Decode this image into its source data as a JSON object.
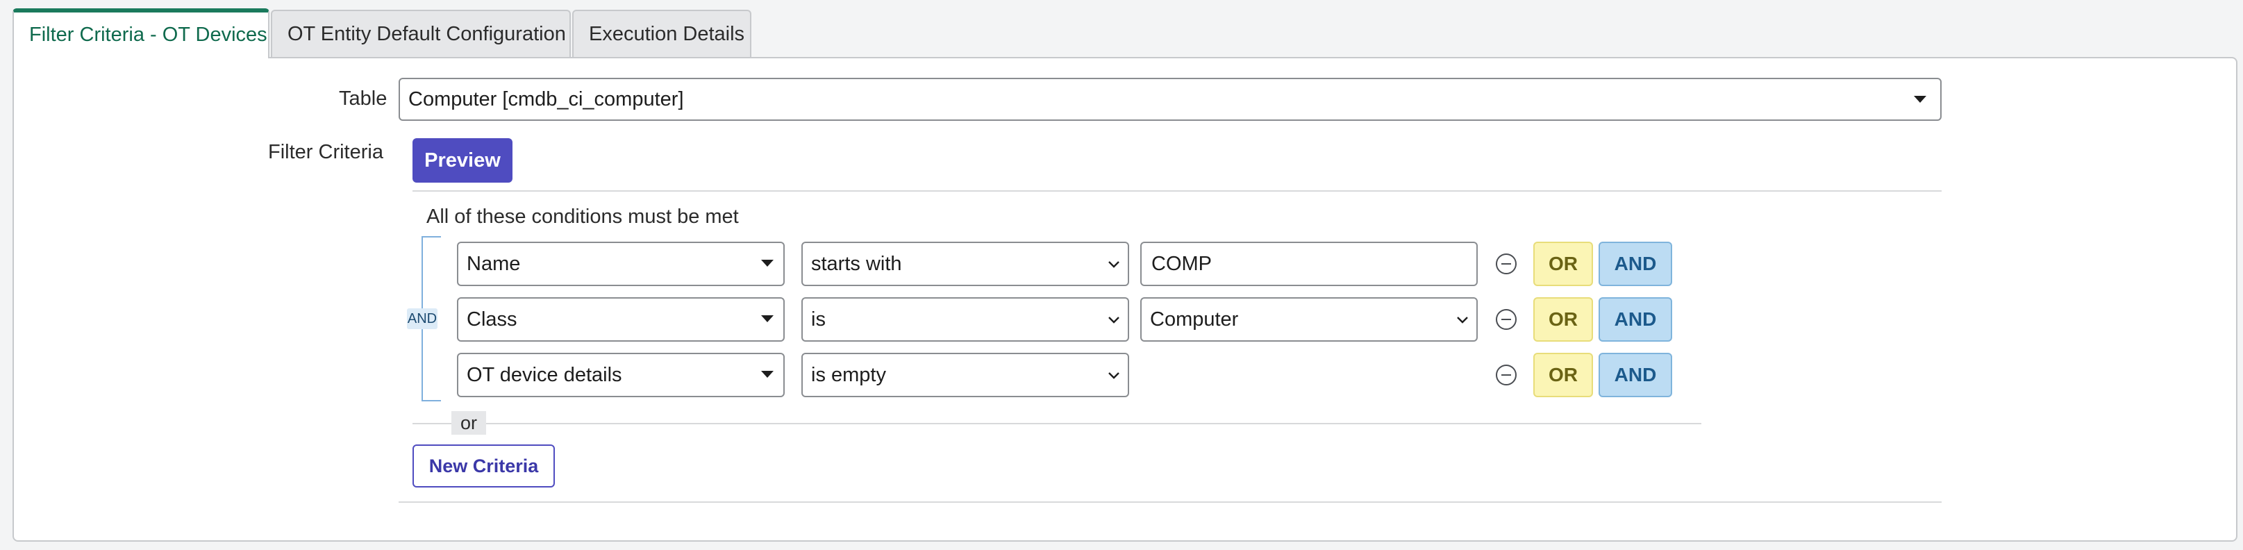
{
  "tabs": [
    {
      "label": "Filter Criteria - OT Devices",
      "active": true
    },
    {
      "label": "OT Entity Default Configuration",
      "active": false
    },
    {
      "label": "Execution Details",
      "active": false
    }
  ],
  "form": {
    "table_label": "Table",
    "table_value": "Computer [cmdb_ci_computer]",
    "filter_label": "Filter Criteria",
    "preview_label": "Preview"
  },
  "conditions": {
    "heading": "All of these conditions must be met",
    "group_operator": "AND",
    "rows": [
      {
        "field": "Name",
        "operator": "starts with",
        "value": "COMP",
        "value_type": "text"
      },
      {
        "field": "Class",
        "operator": "is",
        "value": "Computer",
        "value_type": "select"
      },
      {
        "field": "OT device details",
        "operator": "is empty",
        "value": "",
        "value_type": "none"
      }
    ],
    "or_label": "OR",
    "and_label": "AND",
    "or_separator": "or",
    "new_criteria_label": "New Criteria"
  },
  "colors": {
    "accent_green": "#1a7a5c",
    "primary_button": "#4f4cc0",
    "or_button_bg": "#fbf5b5",
    "and_button_bg": "#bcdcf3"
  }
}
